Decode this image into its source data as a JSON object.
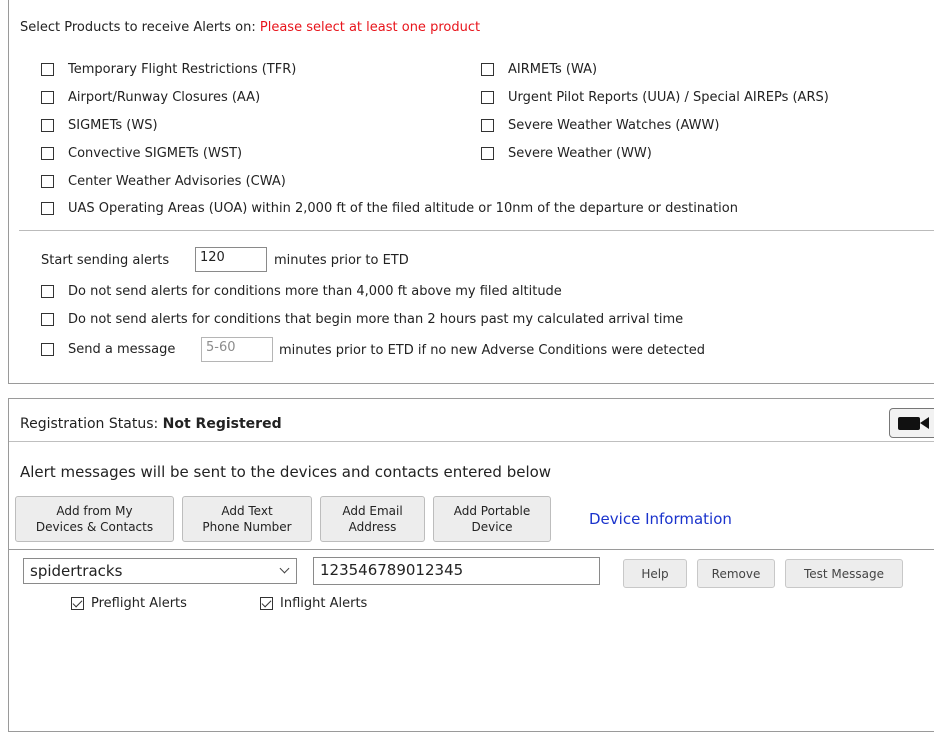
{
  "products": {
    "header": "Select Products to receive Alerts on:",
    "warning": "Please select at least one product",
    "left": [
      {
        "label": "Temporary Flight Restrictions (TFR)",
        "checked": false
      },
      {
        "label": "Airport/Runway Closures (AA)",
        "checked": false
      },
      {
        "label": "SIGMETs (WS)",
        "checked": false
      },
      {
        "label": "Convective SIGMETs (WST)",
        "checked": false
      },
      {
        "label": "Center Weather Advisories (CWA)",
        "checked": false
      }
    ],
    "right": [
      {
        "label": "AIRMETs (WA)",
        "checked": false
      },
      {
        "label": "Urgent Pilot Reports (UUA) / Special AIREPs (ARS)",
        "checked": false
      },
      {
        "label": "Severe Weather Watches (AWW)",
        "checked": false
      },
      {
        "label": "Severe Weather (WW)",
        "checked": false
      }
    ],
    "uoa": {
      "label": "UAS Operating Areas (UOA) within 2,000 ft of the filed altitude or 10nm of the departure or destination",
      "checked": false
    }
  },
  "timing": {
    "start_prefix": "Start sending alerts",
    "start_value": "120",
    "start_suffix": "minutes prior to ETD",
    "opt1": "Do not send alerts for conditions more than 4,000 ft above my filed altitude",
    "opt2": "Do not send alerts for conditions that begin more than 2 hours past my calculated arrival time",
    "msg_prefix": "Send a message",
    "msg_placeholder": "5-60",
    "msg_suffix": "minutes prior to ETD if no new Adverse Conditions were detected"
  },
  "registration": {
    "status_label": "Registration Status:",
    "status_value": "Not Registered",
    "camera_icon": "video-camera-icon",
    "info": "Alert messages will be sent to the devices and contacts entered below",
    "buttons": {
      "add_from_devices": [
        "Add from My",
        "Devices & Contacts"
      ],
      "add_text": [
        "Add Text",
        "Phone Number"
      ],
      "add_email": [
        "Add Email",
        "Address"
      ],
      "add_portable": [
        "Add Portable",
        "Device"
      ]
    },
    "device_info_link": "Device Information"
  },
  "device": {
    "selected_type": "spidertracks",
    "address": "123546789012345",
    "help": "Help",
    "remove": "Remove",
    "test": "Test Message",
    "preflight_label": "Preflight Alerts",
    "preflight_checked": true,
    "inflight_label": "Inflight Alerts",
    "inflight_checked": true
  }
}
